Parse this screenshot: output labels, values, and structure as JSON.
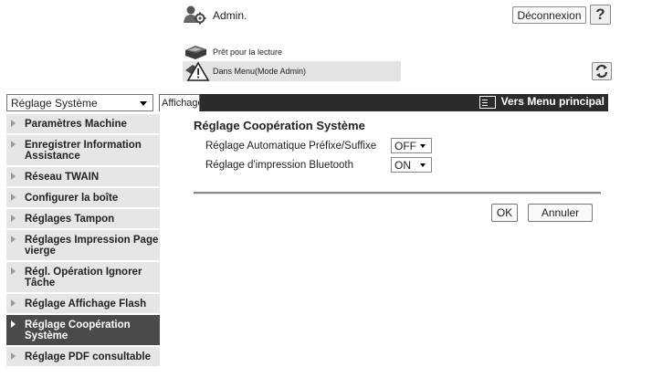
{
  "header": {
    "admin_label": "Admin.",
    "logout_label": "Déconnexion",
    "help_label": "?",
    "status_ready": "Prêt pour la lecture",
    "status_mode": "Dans Menu(Mode Admin)",
    "icons": [
      "admin-user-icon",
      "printer-icon",
      "warning-icon",
      "refresh-icon",
      "help-icon"
    ]
  },
  "nav": {
    "select_value": "Réglage Système",
    "tab_label": "Affichage",
    "main_menu_label": "Vers Menu principal"
  },
  "sidebar": {
    "items": [
      {
        "label": "Paramètres Machine",
        "active": false
      },
      {
        "label": "Enregistrer Information Assistance",
        "active": false
      },
      {
        "label": "Réseau TWAIN",
        "active": false
      },
      {
        "label": "Configurer la boîte",
        "active": false
      },
      {
        "label": "Réglages Tampon",
        "active": false
      },
      {
        "label": "Réglages Impression Page vierge",
        "active": false
      },
      {
        "label": "Régl. Opération Ignorer Tâche",
        "active": false
      },
      {
        "label": "Réglage Affichage Flash",
        "active": false
      },
      {
        "label": "Réglage Coopération Système",
        "active": true
      },
      {
        "label": "Réglage PDF consultable",
        "active": false
      }
    ]
  },
  "content": {
    "title": "Réglage Coopération Système",
    "settings": [
      {
        "label": "Réglage Automatique Préfixe/Suffixe",
        "value": "OFF"
      },
      {
        "label": "Réglage d'impression Bluetooth",
        "value": "ON"
      }
    ],
    "ok_label": "OK",
    "cancel_label": "Annuler"
  },
  "colors": {
    "nav_dark": "#2b2b2b",
    "sidebar_bg": "#e6e6e6",
    "sidebar_active": "#4a4a4a",
    "status_bar": "#e3e3e3"
  }
}
